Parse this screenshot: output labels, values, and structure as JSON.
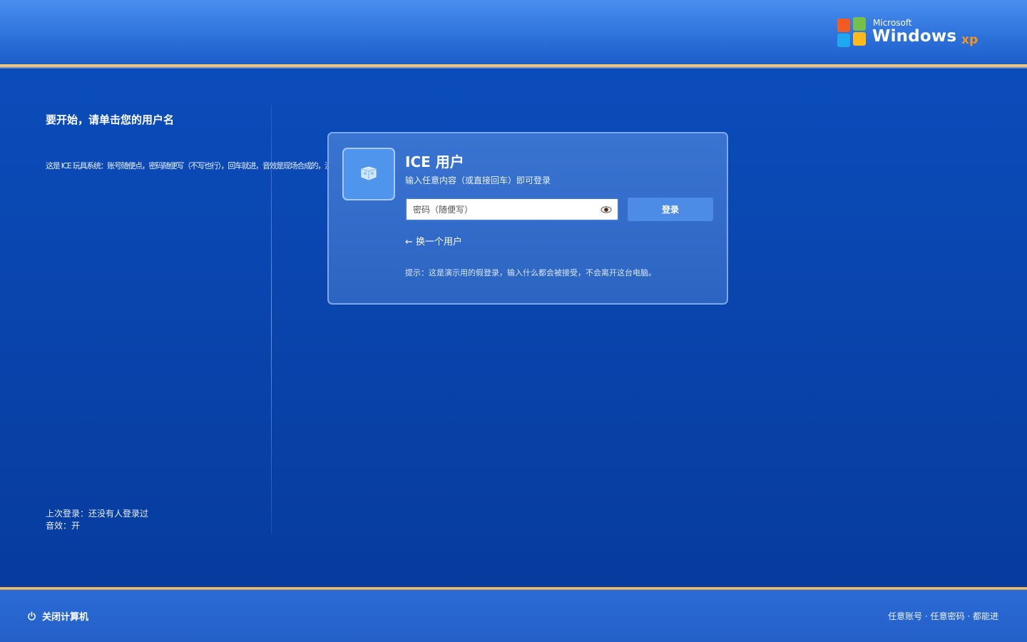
{
  "branding": {
    "microsoft": "Microsoft",
    "windows": "Windows",
    "xp": "xp"
  },
  "left_panel": {
    "title": "要开始，请单击您的用户名",
    "description": "这是 ICE 玩具系统：账号随便点，密码随便写（不写也行），回车就进，音效是现场合成的，没有音频文件。",
    "last_login": "上次登录：还没有人登录过",
    "sound": "音效：开"
  },
  "login_card": {
    "user_name": "ICE 用户",
    "hint": "输入任意内容（或直接回车）即可登录",
    "password_placeholder": "密码（随便写）",
    "password_value": "",
    "login_button": "登录",
    "switch_user": "← 换一个用户",
    "tip": "提示：这是演示用的假登录，输入什么都会被接受，不会离开这台电脑。",
    "avatar_icon": "ice-cube-icon",
    "reveal_icon": "eye-icon"
  },
  "bottom_bar": {
    "shutdown_label": "关闭计算机",
    "shutdown_icon": "power-icon",
    "note": "任意账号 · 任意密码 · 都能进"
  },
  "colors": {
    "background": "#0a46b0",
    "top_bar": "#2e72dc",
    "accent_orange": "#f3a43d",
    "card": "#3070c8",
    "button": "#4c8be6",
    "xp_orange": "#f7941d"
  }
}
